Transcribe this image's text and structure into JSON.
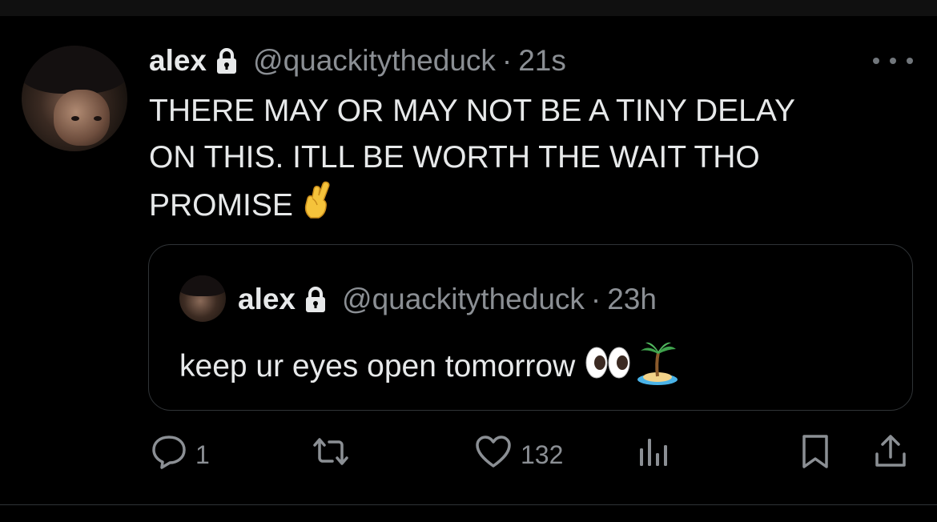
{
  "tweet": {
    "display_name": "alex",
    "handle": "@quackitytheduck",
    "separator": "·",
    "time": "21s",
    "text_lines": [
      "THERE MAY OR MAY NOT BE A TINY DELAY",
      "ON THIS. ITLL BE WORTH THE WAIT THO",
      "PROMISE"
    ],
    "text_emoji": "crossed-fingers-emoji"
  },
  "quote": {
    "display_name": "alex",
    "handle": "@quackitytheduck",
    "separator": "·",
    "time": "23h",
    "text": "keep ur eyes open tomorrow",
    "emojis": [
      "eyes-emoji",
      "desert-island-emoji"
    ]
  },
  "actions": {
    "reply_count": "1",
    "retweet_count": "",
    "like_count": "132",
    "views_count": ""
  },
  "colors": {
    "background": "#000000",
    "text": "#e7e9ea",
    "secondary": "#8b8f94",
    "border": "#2f3336"
  }
}
